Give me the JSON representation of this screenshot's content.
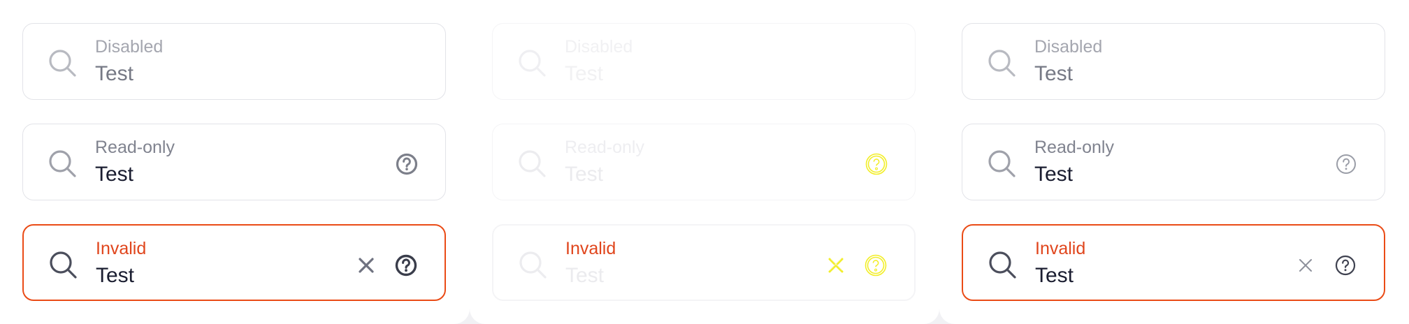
{
  "panels": [
    {
      "name": "default",
      "fields": [
        {
          "label": "Disabled",
          "value": "Test",
          "state": "disabled",
          "icons": [
            "search-icon"
          ]
        },
        {
          "label": "Read-only",
          "value": "Test",
          "state": "read-only",
          "icons": [
            "search-icon",
            "help-icon"
          ]
        },
        {
          "label": "Invalid",
          "value": "Test",
          "state": "invalid",
          "icons": [
            "search-icon",
            "clear-icon",
            "help-icon"
          ]
        }
      ]
    },
    {
      "name": "faded",
      "fields": [
        {
          "label": "Disabled",
          "value": "Test",
          "state": "disabled",
          "icons": [
            "search-icon"
          ]
        },
        {
          "label": "Read-only",
          "value": "Test",
          "state": "read-only",
          "icons": [
            "search-icon",
            "help-icon"
          ]
        },
        {
          "label": "Invalid",
          "value": "Test",
          "state": "invalid",
          "icons": [
            "search-icon",
            "clear-icon",
            "help-icon"
          ]
        }
      ]
    },
    {
      "name": "alternate",
      "fields": [
        {
          "label": "Disabled",
          "value": "Test",
          "state": "disabled",
          "icons": [
            "search-icon"
          ]
        },
        {
          "label": "Read-only",
          "value": "Test",
          "state": "read-only",
          "icons": [
            "search-icon",
            "help-icon"
          ]
        },
        {
          "label": "Invalid",
          "value": "Test",
          "state": "invalid",
          "icons": [
            "search-icon",
            "clear-icon",
            "help-icon"
          ]
        }
      ]
    }
  ],
  "colors": {
    "background": "#f1f1f4",
    "border": "#e2e3e8",
    "invalid_border": "#ea4b16",
    "invalid_label": "#e0451c",
    "text": "#1a1d30",
    "muted": "#80838f",
    "highlight_yellow": "#f2ee2a"
  }
}
